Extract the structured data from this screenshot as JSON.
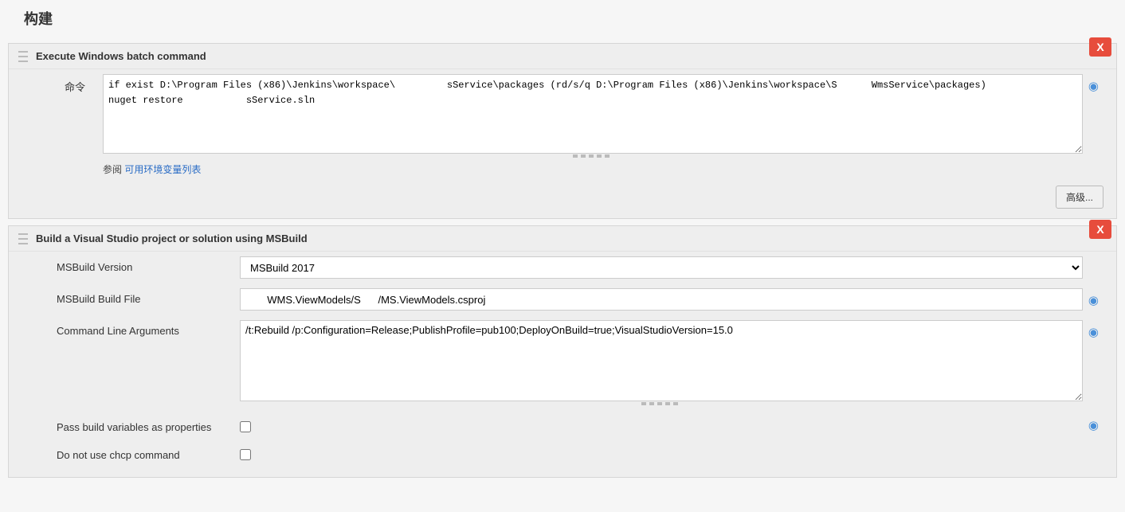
{
  "sectionTitle": "构建",
  "batch": {
    "header": "Execute Windows batch command",
    "cmdLabel": "命令",
    "cmdValue": "if exist D:\\Program Files (x86)\\Jenkins\\workspace\\         sService\\packages (rd/s/q D:\\Program Files (x86)\\Jenkins\\workspace\\S      WmsService\\packages)\nnuget restore           sService.sln",
    "refPrefix": "参阅 ",
    "refLink": "可用环境变量列表",
    "advancedBtn": "高级...",
    "deleteX": "X"
  },
  "msbuild": {
    "header": "Build a Visual Studio project or solution using MSBuild",
    "versionLabel": "MSBuild Version",
    "versionValue": "MSBuild 2017",
    "buildFileLabel": "MSBuild Build File",
    "buildFileValue": "       WMS.ViewModels/S      /MS.ViewModels.csproj",
    "argsLabel": "Command Line Arguments",
    "argsValue": "/t:Rebuild /p:Configuration=Release;PublishProfile=pub100;DeployOnBuild=true;VisualStudioVersion=15.0",
    "passVarsLabel": "Pass build variables as properties",
    "noChcpLabel": "Do not use chcp command",
    "deleteX": "X"
  }
}
